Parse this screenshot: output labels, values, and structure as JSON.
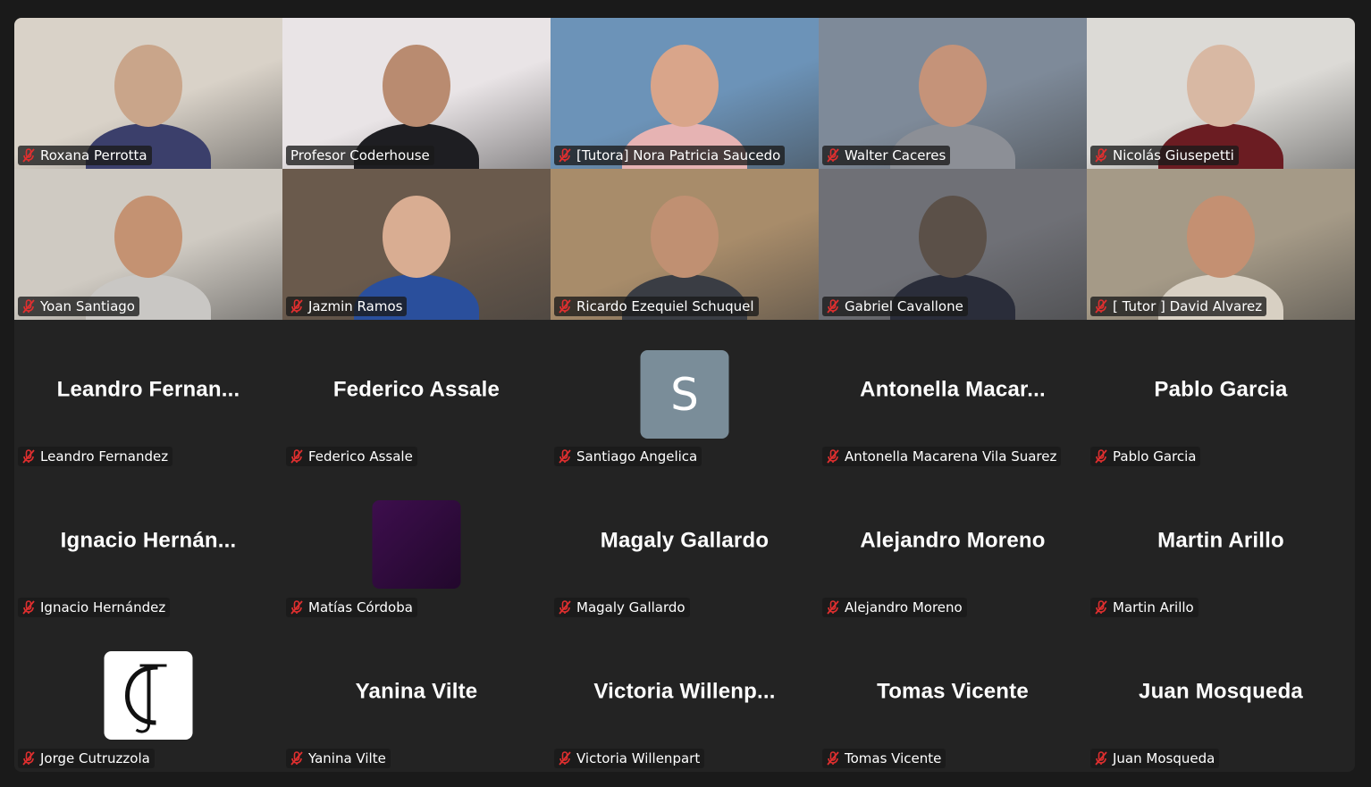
{
  "participants": [
    {
      "label": "Roxana Perrotta",
      "muted": true,
      "video": true,
      "tone": [
        "#d9d2c8",
        "#c9a58a",
        "#3b3f6b"
      ]
    },
    {
      "label": "Profesor Coderhouse",
      "muted": false,
      "video": true,
      "active": true,
      "tone": [
        "#e9e4e6",
        "#b98b70",
        "#1e1e22"
      ]
    },
    {
      "label": "[Tutora] Nora Patricia Saucedo",
      "muted": true,
      "video": true,
      "tone": [
        "#6c93b8",
        "#d9a58a",
        "#e6b3b3"
      ]
    },
    {
      "label": "Walter Caceres",
      "muted": true,
      "video": true,
      "tone": [
        "#7e8a99",
        "#c59379",
        "#8c8f96"
      ]
    },
    {
      "label": "Nicolás Giusepetti",
      "muted": true,
      "video": true,
      "tone": [
        "#dcdad6",
        "#d8b8a3",
        "#6b1c22"
      ]
    },
    {
      "label": "Yoan Santiago",
      "muted": true,
      "video": true,
      "tone": [
        "#cfcac2",
        "#c49272",
        "#c9c7c4"
      ]
    },
    {
      "label": "Jazmin Ramos",
      "muted": true,
      "video": true,
      "tone": [
        "#6a5a4c",
        "#d9ad92",
        "#2a4f9c"
      ]
    },
    {
      "label": "Ricardo Ezequiel Schuquel",
      "muted": true,
      "video": true,
      "tone": [
        "#a88c6a",
        "#c09072",
        "#3a3d44"
      ]
    },
    {
      "label": "Gabriel Cavallone",
      "muted": true,
      "video": true,
      "tone": [
        "#6f7076",
        "#5b5048",
        "#2a2d3a"
      ]
    },
    {
      "label": "[ Tutor ] David Alvarez",
      "muted": true,
      "video": true,
      "tone": [
        "#a59a87",
        "#c49072",
        "#d8d0c3"
      ]
    },
    {
      "label": "Leandro Fernandez",
      "display": "Leandro  Fernan...",
      "muted": true,
      "video": false
    },
    {
      "label": "Federico Assale",
      "display": "Federico Assale",
      "muted": true,
      "video": false
    },
    {
      "label": "Santiago Angelica",
      "avatar": "letter",
      "avatar_text": "S",
      "muted": true,
      "video": false
    },
    {
      "label": "Antonella Macarena Vila Suarez",
      "display": "Antonella  Macar...",
      "muted": true,
      "video": false
    },
    {
      "label": "Pablo Garcia",
      "display": "Pablo Garcia",
      "muted": true,
      "video": false
    },
    {
      "label": "Ignacio Hernández",
      "display": "Ignacio  Hernán...",
      "muted": true,
      "video": false
    },
    {
      "label": "Matías Córdoba",
      "avatar": "purple",
      "muted": true,
      "video": false
    },
    {
      "label": "Magaly Gallardo",
      "display": "Magaly Gallardo",
      "muted": true,
      "video": false
    },
    {
      "label": "Alejandro Moreno",
      "display": "Alejandro Moreno",
      "muted": true,
      "video": false
    },
    {
      "label": "Martin Arillo",
      "display": "Martin Arillo",
      "muted": true,
      "video": false
    },
    {
      "label": "Jorge Cutruzzola",
      "avatar": "logo",
      "muted": true,
      "video": false
    },
    {
      "label": "Yanina Vilte",
      "display": "Yanina Vilte",
      "muted": true,
      "video": false
    },
    {
      "label": "Victoria Willenpart",
      "display": "Victoria  Willenp...",
      "muted": true,
      "video": false
    },
    {
      "label": "Tomas Vicente",
      "display": "Tomas Vicente",
      "muted": true,
      "video": false
    },
    {
      "label": "Juan Mosqueda",
      "display": "Juan Mosqueda",
      "muted": true,
      "video": false
    }
  ],
  "icons": {
    "muted": "microphone-muted-icon"
  },
  "colors": {
    "active_speaker": "#23d959",
    "mute": "#e02f2f",
    "background": "#1a1a1a",
    "tile": "#232323"
  }
}
